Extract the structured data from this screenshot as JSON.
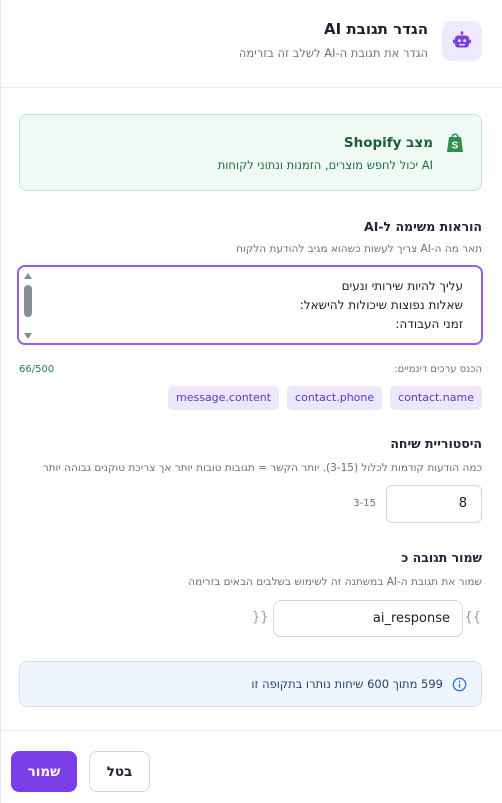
{
  "header": {
    "title": "הגדר תגובת AI",
    "subtitle": "הגדר את תגובת ה-AI לשלב זה בזרימה",
    "icon": "robot-icon"
  },
  "shopify": {
    "title": "מצב Shopify",
    "subtitle": "AI יכול לחפש מוצרים, הזמנות ונתוני לקוחות",
    "icon": "shopify-bag-icon"
  },
  "instructions": {
    "label": "הוראות משימה ל-AI",
    "hint": "תאר מה ה-AI צריך לעשות כשהוא מגיב להודעת הלקוח",
    "lines": [
      "עליך להיות שירותי ונעים",
      "שאלות נפוצות שיכולות להישאל:",
      "זמני העבודה:"
    ],
    "counter": "66/500"
  },
  "dynamic": {
    "label": "הכנס ערכים דינמיים:",
    "chips": [
      "contact.name",
      "contact.phone",
      "message.content"
    ]
  },
  "history": {
    "label": "היסטוריית שיחה",
    "hint": "כמה הודעות קודמות לכלול (3-15). יותר הקשר = תגובות טובות יותר אך צריכת טוקנים גבוהה יותר",
    "value": "8",
    "range": "3-15"
  },
  "save_as": {
    "label": "שמור תגובה כ",
    "hint": "שמור את תגובת ה-AI במשתנה זה לשימוש בשלבים הבאים בזרימה",
    "value": "ai_response",
    "brace_open": "{{",
    "brace_close": "}}"
  },
  "info": {
    "text": "599 מתוך 600 שיחות נותרו בתקופה זו",
    "icon": "info-icon"
  },
  "footer": {
    "save_label": "שמור",
    "cancel_label": "בטל"
  },
  "colors": {
    "accent": "#7b3fe8",
    "shopify_bg": "#eefaf3",
    "info_bg": "#eef5fd"
  }
}
